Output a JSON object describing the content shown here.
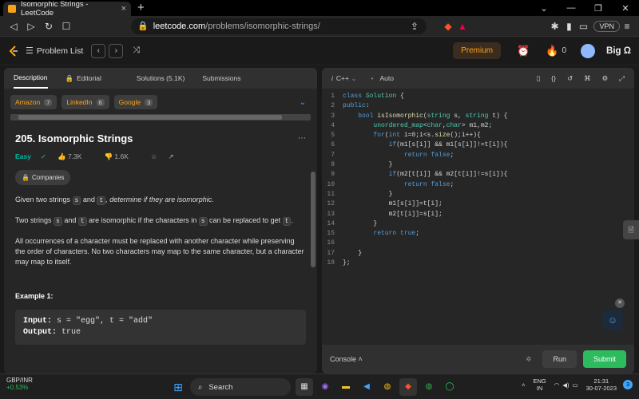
{
  "browser": {
    "tab_title": "Isomorphic Strings - LeetCode",
    "url_host": "leetcode.com",
    "url_path": "/problems/isomorphic-strings/",
    "vpn_label": "VPN"
  },
  "header": {
    "problem_list": "Problem List",
    "premium": "Premium",
    "notifications": "0",
    "username": "Big Ω"
  },
  "left": {
    "tabs": [
      "Description",
      "Editorial",
      "Solutions (5.1K)",
      "Submissions"
    ],
    "companies": [
      {
        "name": "Amazon",
        "count": "7"
      },
      {
        "name": "LinkedIn",
        "count": "6"
      },
      {
        "name": "Google",
        "count": "3"
      }
    ],
    "title": "205. Isomorphic Strings",
    "difficulty": "Easy",
    "likes": "7.3K",
    "dislikes": "1.6K",
    "companies_label": "Companies",
    "p1_a": "Given two strings ",
    "p1_s": "s",
    "p1_b": " and ",
    "p1_t": "t",
    "p1_c": ", determine if they are isomorphic.",
    "p2_a": "Two strings ",
    "p2_s": "s",
    "p2_b": " and ",
    "p2_t": "t",
    "p2_c": " are isomorphic if the characters in ",
    "p2_s2": "s",
    "p2_d": " can be replaced to get ",
    "p2_t2": "t",
    "p2_e": ".",
    "p3": "All occurrences of a character must be replaced with another character while preserving the order of characters. No two characters may map to the same character, but a character may map to itself.",
    "example_title": "Example 1:",
    "ex_input_label": "Input:",
    "ex_input": " s = \"egg\", t = \"add\"",
    "ex_output_label": "Output:",
    "ex_output": " true"
  },
  "right": {
    "language": "C++",
    "mode": "Auto",
    "console": "Console",
    "run": "Run",
    "submit": "Submit"
  },
  "code_lines": [
    "class Solution {",
    "public:",
    "    bool isIsomorphic(string s, string t) {",
    "        unordered_map<char,char> m1,m2;",
    "        for(int i=0;i<s.size();i++){",
    "            if(m1[s[i]] && m1[s[i]]!=t[i]){",
    "                return false;",
    "            }",
    "            if(m2[t[i]] && m2[t[i]]!=s[i]){",
    "                return false;",
    "            }",
    "            m1[s[i]]=t[i];",
    "            m2[t[i]]=s[i];",
    "        }",
    "        return true;",
    "",
    "    }",
    "};"
  ],
  "taskbar": {
    "ticker_name": "GBP/INR",
    "ticker_change": "+0.53%",
    "search": "Search",
    "lang": "ENG",
    "region": "IN",
    "time": "21:31",
    "date": "30-07-2023"
  }
}
